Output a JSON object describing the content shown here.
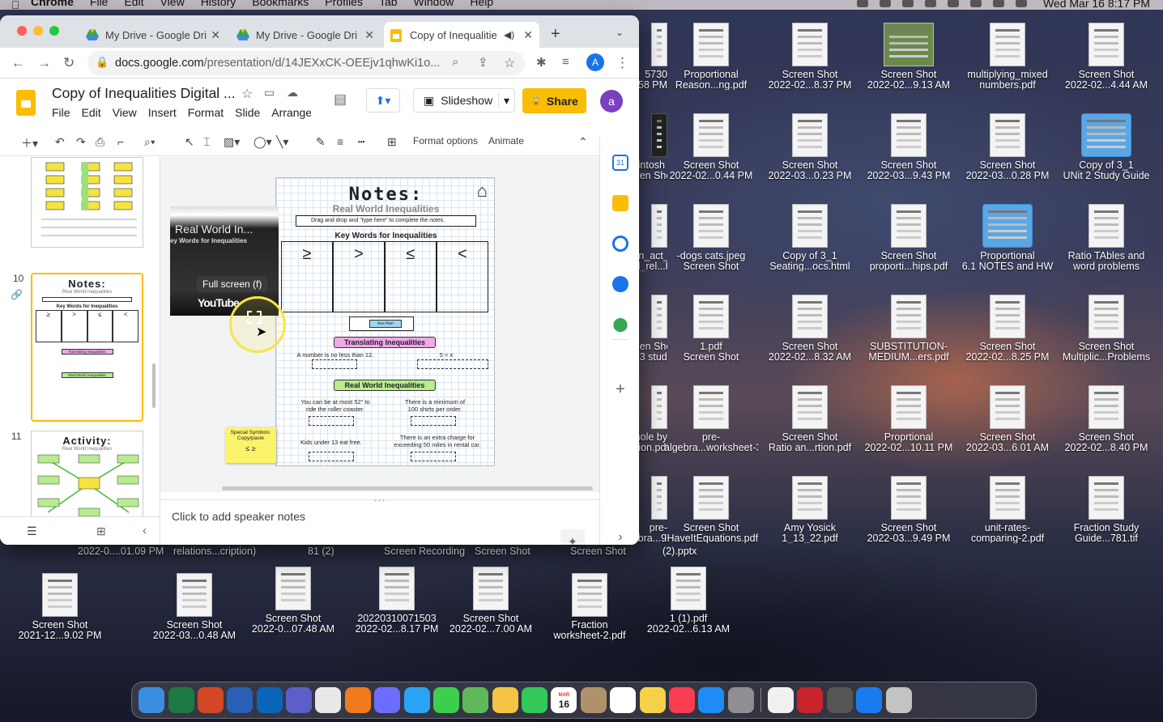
{
  "menubar": {
    "app": "Chrome",
    "items": [
      "File",
      "Edit",
      "View",
      "History",
      "Bookmarks",
      "Profiles",
      "Tab",
      "Window",
      "Help"
    ],
    "clock": "Wed Mar 16  8:17 PM"
  },
  "browser": {
    "tabs": [
      {
        "title": "My Drive - Google Dri",
        "active": false
      },
      {
        "title": "My Drive - Google Dri",
        "active": false
      },
      {
        "title": "Copy of Inequalitie",
        "active": true
      }
    ],
    "new_tab": "+",
    "url_host": "docs.google.com",
    "url_path": "/presentation/d/14JEXxCK-OEEjv1qhwKi1o...",
    "profile_initial": "A"
  },
  "slides": {
    "doc_title": "Copy of Inequalities Digital ...",
    "menus": [
      "File",
      "Edit",
      "View",
      "Insert",
      "Format",
      "Slide",
      "Arrange",
      "To"
    ],
    "slideshow_label": "Slideshow",
    "share_label": "Share",
    "avatar_initial": "a",
    "format_options": "Format options",
    "animate": "Animate",
    "speaker_notes_placeholder": "Click to add speaker notes",
    "slide_numbers": [
      "10",
      "11"
    ],
    "tooltip": "Full screen (f)",
    "video": {
      "title": "Real World In...",
      "subtitle": "ey Words for Inequalities",
      "brand": "YouTube"
    },
    "slide": {
      "title": "Notes:",
      "subtitle": "Real World Inequalities",
      "instruction": "Drag and drop and \"type here\" to complete the notes.",
      "keywords_heading": "Key Words for Inequalities",
      "symbols": [
        "≥",
        ">",
        "≤",
        "<"
      ],
      "tile": "less than",
      "translating_heading": "Translating Inequalities",
      "statement_1": "A number is no less than 12.",
      "statement_1_answer": "5 < x",
      "realworld_heading": "Real World Inequalities",
      "rw_1": "You can be at most 52\" to ride the roller coaster.",
      "rw_2": "There is a minimum of 100 shirts per order.",
      "rw_3": "Kids under 13 eat free.",
      "rw_4": "There is an extra charge for exceeding 50 miles in rental car.",
      "sticky_title": "Special Symbols: Copy/paste",
      "sticky_symbols": "≤   ≥"
    },
    "thumb10": {
      "title": "Notes:",
      "subtitle": "Real World Inequalities",
      "heading": "Key Words for Inequalities",
      "symbols": [
        "≥",
        ">",
        "≤",
        "<"
      ],
      "translating": "Translating Inequalities",
      "realworld": "Real World Inequalities"
    },
    "thumb11": {
      "title": "Activity:",
      "subtitle": "Real World Inequalities"
    }
  },
  "desktop_icons": [
    {
      "l1": "5730",
      "l2": "...58 PM",
      "t": "doc"
    },
    {
      "l1": "Proportional",
      "l2": "Reason...ng.pdf",
      "t": "doc"
    },
    {
      "l1": "Screen Shot",
      "l2": "2022-02...8.37 PM",
      "t": "doc"
    },
    {
      "l1": "Screen Shot",
      "l2": "2022-02...9.13 AM",
      "t": "photo"
    },
    {
      "l1": "multiplying_mixed",
      "l2": "numbers.pdf",
      "t": "doc"
    },
    {
      "l1": "Screen Shot",
      "l2": "2022-02...4.44 AM",
      "t": "doc"
    },
    {
      "l1": "Macintosh HD",
      "l2": "Screen Shot",
      "t": "hd"
    },
    {
      "l1": "Screen Shot",
      "l2": "2022-02...0.44 PM",
      "t": "doc"
    },
    {
      "l1": "Screen Shot",
      "l2": "2022-03...0.23 PM",
      "t": "doc"
    },
    {
      "l1": "Screen Shot",
      "l2": "2022-03...9.43 PM",
      "t": "doc"
    },
    {
      "l1": "Screen Shot",
      "l2": "2022-03...0.28 PM",
      "t": "doc"
    },
    {
      "l1": "Copy of 3_1",
      "l2": "UNit 2 Study Guide",
      "t": "folder"
    },
    {
      "l1": "muen_act_proport",
      "l2": "ional_rel...hips.pdf",
      "t": "doc"
    },
    {
      "l1": "-dogs cats.jpeg",
      "l2": "Screen Shot",
      "t": "doc"
    },
    {
      "l1": "Copy of 3_1",
      "l2": "Seating...ocs.html",
      "t": "doc"
    },
    {
      "l1": "Screen Shot",
      "l2": "proporti...hips.pdf",
      "t": "doc"
    },
    {
      "l1": "Proportional",
      "l2": "6.1 NOTES and HW",
      "t": "folder"
    },
    {
      "l1": "Ratio TAbles and",
      "l2": "word problems",
      "t": "doc"
    },
    {
      "l1": "Screen Shot",
      "l2": "Unit 3 study",
      "t": "doc"
    },
    {
      "l1": "1.pdf",
      "l2": "Screen Shot",
      "t": "doc"
    },
    {
      "l1": "Screen Shot",
      "l2": "2022-02...8.32 AM",
      "t": "doc"
    },
    {
      "l1": "SUBSTITUTION-",
      "l2": "MEDIUM...ers.pdf",
      "t": "doc"
    },
    {
      "l1": "Screen Shot",
      "l2": "2022-02...8.25 PM",
      "t": "doc"
    },
    {
      "l1": "Screen Shot",
      "l2": "Multiplic...Problems",
      "t": "doc"
    },
    {
      "l1": "whole by",
      "l2": "fraction.pdf",
      "t": "doc"
    },
    {
      "l1": "pre-",
      "l2": "algebra...worksheet-3.pdf",
      "t": "doc"
    },
    {
      "l1": "Screen Shot",
      "l2": "Ratio an...rtion.pdf",
      "t": "doc"
    },
    {
      "l1": "Proprtional",
      "l2": "2022-02...10.11 PM",
      "t": "doc"
    },
    {
      "l1": "Screen Shot",
      "l2": "2022-03...6.01 AM",
      "t": "doc"
    },
    {
      "l1": "Screen Shot",
      "l2": "2022-02...8.40 PM",
      "t": "doc"
    },
    {
      "l1": "pre-",
      "l2": "algebra...9.57 AM",
      "t": "doc"
    },
    {
      "l1": "Screen Shot",
      "l2": "IHaveItEquations.pdf",
      "t": "doc"
    },
    {
      "l1": "Amy Yosick",
      "l2": "1_13_22.pdf",
      "t": "doc"
    },
    {
      "l1": "Screen Shot",
      "l2": "2022-03...9.49 PM",
      "t": "doc"
    },
    {
      "l1": "unit-rates-",
      "l2": "comparing-2.pdf",
      "t": "doc"
    },
    {
      "l1": "Fraction Study",
      "l2": "Guide...781.tif",
      "t": "doc"
    },
    {
      "l1": "Screen Shot",
      "l2": "2021-12...9.02 PM",
      "t": "doc"
    },
    {
      "l1": "Screen Shot",
      "l2": "2022-03...0.48 AM",
      "t": "doc"
    },
    {
      "l1": "Screen Shot",
      "l2": "2022-0...07.48 AM",
      "t": "doc"
    },
    {
      "l1": "20220310071503",
      "l2": "2022-02...8.17 PM",
      "t": "doc"
    },
    {
      "l1": "Screen Shot",
      "l2": "2022-02...7.00 AM",
      "t": "doc"
    },
    {
      "l1": "Fraction",
      "l2": "worksheet-2.pdf",
      "t": "doc"
    },
    {
      "l1": "1 (1).pdf",
      "l2": "2022-02...6.13 AM",
      "t": "doc"
    }
  ],
  "desktop_row_labels": [
    "2022-0....01.09 PM",
    "relations...cription)",
    "81 (2)",
    "Screen Recording",
    "Screen Shot",
    "Screen Shot",
    "(2).pptx"
  ],
  "dock": {
    "items": [
      "finder",
      "excel",
      "powerpoint",
      "word",
      "outlook",
      "teams",
      "chrome",
      "firefox",
      "launchpad",
      "safari",
      "messages",
      "maps",
      "photos",
      "facetime",
      "calendar",
      "contacts",
      "reminders",
      "notes",
      "music",
      "appstore",
      "settings",
      "textedit",
      "acrobat",
      "camera",
      "xcode",
      "photobooth"
    ],
    "calendar_month": "MAR",
    "calendar_day": "16"
  }
}
